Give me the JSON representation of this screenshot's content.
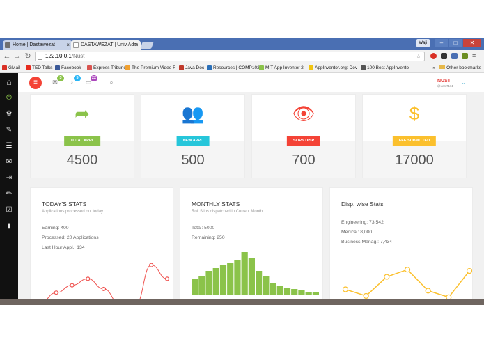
{
  "browser": {
    "tabs": [
      {
        "title": "Home | Dastawezat",
        "fav_color": "#6f6f6f"
      },
      {
        "title": "DASTAWEZAT | Univ Adm",
        "fav_color": "#999999"
      }
    ],
    "window_user": "Waji",
    "url_host": "122.10.0.1",
    "url_path": "/Nust",
    "bookmarks": [
      {
        "label": "GMail",
        "color": "#d93025"
      },
      {
        "label": "TED Talks",
        "color": "#e62b1e"
      },
      {
        "label": "Facebook",
        "color": "#3b5998"
      },
      {
        "label": "Express Tribune",
        "color": "#d9534f"
      },
      {
        "label": "The Premium Video F",
        "color": "#f0a030"
      },
      {
        "label": "Java Doc",
        "color": "#c0392b"
      },
      {
        "label": "Resources | COMP102",
        "color": "#2a6fb8"
      },
      {
        "label": "MIT App Inventor 2",
        "color": "#8bc34a"
      },
      {
        "label": "AppInventor.org: Dev",
        "color": "#f1c40f"
      },
      {
        "label": "100 Best AppInvento",
        "color": "#555555"
      }
    ],
    "bookmarks_more": "»",
    "other_bookmarks": "Other bookmarks"
  },
  "header": {
    "badges": [
      {
        "icon": "mail-icon",
        "count": "3",
        "color": "#8bc34a"
      },
      {
        "icon": "bell-icon",
        "count": "5",
        "color": "#29b6f6"
      },
      {
        "icon": "inbox-icon",
        "count": "22",
        "color": "#ab47bc"
      }
    ],
    "user_name": "NUST",
    "user_sub": "@uest7161"
  },
  "sidebar": {
    "icons": [
      "home-icon",
      "power-icon",
      "gear-icon",
      "brush-icon",
      "list-icon",
      "mail-icon",
      "login-icon",
      "pencil-icon",
      "edit-icon",
      "book-icon"
    ]
  },
  "cards": [
    {
      "label": "TOTAL APPL",
      "value": "4500",
      "color": "#8bc34a",
      "icon": "share-arrow-icon"
    },
    {
      "label": "NEW APPL",
      "value": "500",
      "color": "#26c6da",
      "icon": "users-icon"
    },
    {
      "label": "SLIPS DISP",
      "value": "700",
      "color": "#f44336",
      "icon": "eye-icon"
    },
    {
      "label": "FEE SUBMITTED",
      "value": "17000",
      "color": "#fbc02d",
      "icon": "dollar-icon"
    }
  ],
  "today": {
    "title": "TODAY'S STATS",
    "subtitle": "Applications processed out today",
    "lines": [
      "Earning: 400",
      "Processed: 20 Applications",
      "Last Hour Appl.: 134"
    ]
  },
  "monthly": {
    "title": "MONTHLY STATS",
    "subtitle": "Roll Slips dispatched in Current Month",
    "lines": [
      "Total: 5000",
      "Remaining: 250"
    ]
  },
  "discipline": {
    "title": "Disp. wise Stats",
    "lines": [
      "Engineering: 73,542",
      "Medical: 8,000",
      "Business Manag.: 7,434"
    ]
  },
  "chart_data": [
    {
      "type": "line",
      "title": "",
      "values": [
        8,
        30,
        46,
        60,
        38,
        6,
        4,
        90,
        60
      ],
      "color": "#ef5350",
      "ylim": [
        0,
        100
      ]
    },
    {
      "type": "bar",
      "title": "",
      "values": [
        22,
        26,
        34,
        38,
        42,
        46,
        50,
        61,
        52,
        34,
        26,
        16,
        13,
        10,
        8,
        6,
        4,
        3
      ],
      "color": "#8bc34a",
      "ylim": [
        0,
        65
      ]
    },
    {
      "type": "line",
      "title": "",
      "values": [
        26,
        16,
        45,
        56,
        24,
        14,
        54
      ],
      "color": "#fbc02d",
      "ylim": [
        0,
        70
      ]
    }
  ]
}
